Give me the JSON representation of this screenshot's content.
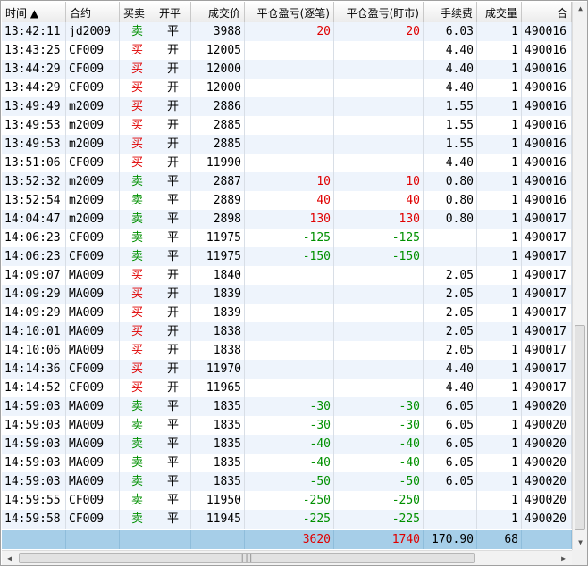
{
  "headers": {
    "time": "时间",
    "sort_arrow": "▲",
    "contract": "合约",
    "direction": "买卖",
    "offset": "开平",
    "price": "成交价",
    "pnl_trade": "平仓盈亏(逐笔)",
    "pnl_mtm": "平仓盈亏(盯市)",
    "fee": "手续费",
    "qty": "成交量",
    "id_partial": "合"
  },
  "rows": [
    {
      "time": "13:42:11",
      "contract": "jd2009",
      "dir": "卖",
      "offset": "平",
      "price": "3988",
      "pnl1": "20",
      "pnl2": "20",
      "fee": "6.03",
      "qty": "1",
      "id": "490016"
    },
    {
      "time": "13:43:25",
      "contract": "CF009",
      "dir": "买",
      "offset": "开",
      "price": "12005",
      "pnl1": "",
      "pnl2": "",
      "fee": "4.40",
      "qty": "1",
      "id": "490016"
    },
    {
      "time": "13:44:29",
      "contract": "CF009",
      "dir": "买",
      "offset": "开",
      "price": "12000",
      "pnl1": "",
      "pnl2": "",
      "fee": "4.40",
      "qty": "1",
      "id": "490016"
    },
    {
      "time": "13:44:29",
      "contract": "CF009",
      "dir": "买",
      "offset": "开",
      "price": "12000",
      "pnl1": "",
      "pnl2": "",
      "fee": "4.40",
      "qty": "1",
      "id": "490016"
    },
    {
      "time": "13:49:49",
      "contract": "m2009",
      "dir": "买",
      "offset": "开",
      "price": "2886",
      "pnl1": "",
      "pnl2": "",
      "fee": "1.55",
      "qty": "1",
      "id": "490016"
    },
    {
      "time": "13:49:53",
      "contract": "m2009",
      "dir": "买",
      "offset": "开",
      "price": "2885",
      "pnl1": "",
      "pnl2": "",
      "fee": "1.55",
      "qty": "1",
      "id": "490016"
    },
    {
      "time": "13:49:53",
      "contract": "m2009",
      "dir": "买",
      "offset": "开",
      "price": "2885",
      "pnl1": "",
      "pnl2": "",
      "fee": "1.55",
      "qty": "1",
      "id": "490016"
    },
    {
      "time": "13:51:06",
      "contract": "CF009",
      "dir": "买",
      "offset": "开",
      "price": "11990",
      "pnl1": "",
      "pnl2": "",
      "fee": "4.40",
      "qty": "1",
      "id": "490016"
    },
    {
      "time": "13:52:32",
      "contract": "m2009",
      "dir": "卖",
      "offset": "平",
      "price": "2887",
      "pnl1": "10",
      "pnl2": "10",
      "fee": "0.80",
      "qty": "1",
      "id": "490016"
    },
    {
      "time": "13:52:54",
      "contract": "m2009",
      "dir": "卖",
      "offset": "平",
      "price": "2889",
      "pnl1": "40",
      "pnl2": "40",
      "fee": "0.80",
      "qty": "1",
      "id": "490016"
    },
    {
      "time": "14:04:47",
      "contract": "m2009",
      "dir": "卖",
      "offset": "平",
      "price": "2898",
      "pnl1": "130",
      "pnl2": "130",
      "fee": "0.80",
      "qty": "1",
      "id": "490017"
    },
    {
      "time": "14:06:23",
      "contract": "CF009",
      "dir": "卖",
      "offset": "平",
      "price": "11975",
      "pnl1": "-125",
      "pnl2": "-125",
      "fee": "",
      "qty": "1",
      "id": "490017"
    },
    {
      "time": "14:06:23",
      "contract": "CF009",
      "dir": "卖",
      "offset": "平",
      "price": "11975",
      "pnl1": "-150",
      "pnl2": "-150",
      "fee": "",
      "qty": "1",
      "id": "490017"
    },
    {
      "time": "14:09:07",
      "contract": "MA009",
      "dir": "买",
      "offset": "开",
      "price": "1840",
      "pnl1": "",
      "pnl2": "",
      "fee": "2.05",
      "qty": "1",
      "id": "490017"
    },
    {
      "time": "14:09:29",
      "contract": "MA009",
      "dir": "买",
      "offset": "开",
      "price": "1839",
      "pnl1": "",
      "pnl2": "",
      "fee": "2.05",
      "qty": "1",
      "id": "490017"
    },
    {
      "time": "14:09:29",
      "contract": "MA009",
      "dir": "买",
      "offset": "开",
      "price": "1839",
      "pnl1": "",
      "pnl2": "",
      "fee": "2.05",
      "qty": "1",
      "id": "490017"
    },
    {
      "time": "14:10:01",
      "contract": "MA009",
      "dir": "买",
      "offset": "开",
      "price": "1838",
      "pnl1": "",
      "pnl2": "",
      "fee": "2.05",
      "qty": "1",
      "id": "490017"
    },
    {
      "time": "14:10:06",
      "contract": "MA009",
      "dir": "买",
      "offset": "开",
      "price": "1838",
      "pnl1": "",
      "pnl2": "",
      "fee": "2.05",
      "qty": "1",
      "id": "490017"
    },
    {
      "time": "14:14:36",
      "contract": "CF009",
      "dir": "买",
      "offset": "开",
      "price": "11970",
      "pnl1": "",
      "pnl2": "",
      "fee": "4.40",
      "qty": "1",
      "id": "490017"
    },
    {
      "time": "14:14:52",
      "contract": "CF009",
      "dir": "买",
      "offset": "开",
      "price": "11965",
      "pnl1": "",
      "pnl2": "",
      "fee": "4.40",
      "qty": "1",
      "id": "490017"
    },
    {
      "time": "14:59:03",
      "contract": "MA009",
      "dir": "卖",
      "offset": "平",
      "price": "1835",
      "pnl1": "-30",
      "pnl2": "-30",
      "fee": "6.05",
      "qty": "1",
      "id": "490020"
    },
    {
      "time": "14:59:03",
      "contract": "MA009",
      "dir": "卖",
      "offset": "平",
      "price": "1835",
      "pnl1": "-30",
      "pnl2": "-30",
      "fee": "6.05",
      "qty": "1",
      "id": "490020"
    },
    {
      "time": "14:59:03",
      "contract": "MA009",
      "dir": "卖",
      "offset": "平",
      "price": "1835",
      "pnl1": "-40",
      "pnl2": "-40",
      "fee": "6.05",
      "qty": "1",
      "id": "490020"
    },
    {
      "time": "14:59:03",
      "contract": "MA009",
      "dir": "卖",
      "offset": "平",
      "price": "1835",
      "pnl1": "-40",
      "pnl2": "-40",
      "fee": "6.05",
      "qty": "1",
      "id": "490020"
    },
    {
      "time": "14:59:03",
      "contract": "MA009",
      "dir": "卖",
      "offset": "平",
      "price": "1835",
      "pnl1": "-50",
      "pnl2": "-50",
      "fee": "6.05",
      "qty": "1",
      "id": "490020"
    },
    {
      "time": "14:59:55",
      "contract": "CF009",
      "dir": "卖",
      "offset": "平",
      "price": "11950",
      "pnl1": "-250",
      "pnl2": "-250",
      "fee": "",
      "qty": "1",
      "id": "490020"
    },
    {
      "time": "14:59:58",
      "contract": "CF009",
      "dir": "卖",
      "offset": "平",
      "price": "11945",
      "pnl1": "-225",
      "pnl2": "-225",
      "fee": "",
      "qty": "1",
      "id": "490020"
    }
  ],
  "totals": {
    "pnl1": "3620",
    "pnl2": "1740",
    "fee": "170.90",
    "qty": "68"
  },
  "scrollbar": {
    "thumb_grip": "|||"
  },
  "colors": {
    "buy": "#e00000",
    "sell": "#009000",
    "total_bg": "#a6cee8",
    "row_alt": "#eef4fc"
  }
}
